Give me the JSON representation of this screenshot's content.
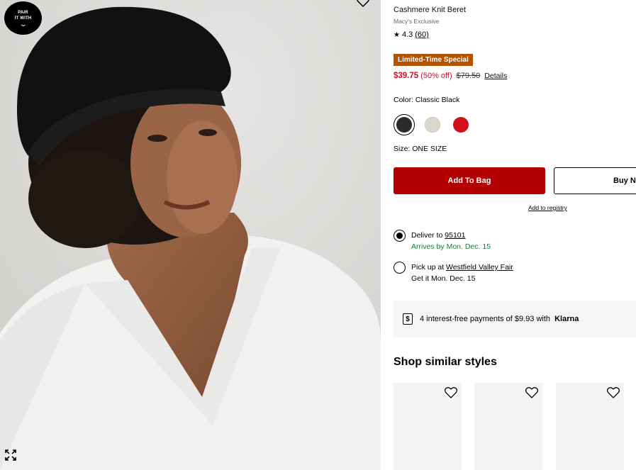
{
  "gallery": {
    "pair_line1": "PAIR",
    "pair_line2": "IT WITH",
    "icons": [
      "chevron-down-icon",
      "expand-icon",
      "heart-icon"
    ]
  },
  "product": {
    "title": "Cashmere Knit Beret",
    "brand": "Macy's Exclusive",
    "rating": "4.3",
    "review_count": "(60)",
    "badge": "Limited-Time Special",
    "sale_price": "$39.75",
    "discount": "(50% off)",
    "original_price": "$79.50",
    "details_link": "Details",
    "color_label": "Color: Classic Black",
    "swatches": [
      {
        "name": "Classic Black",
        "color": "#2b2b2b",
        "selected": true
      },
      {
        "name": "Oatmeal",
        "color": "#ddd6cc",
        "selected": false
      },
      {
        "name": "Red",
        "color": "#d0101c",
        "selected": false
      }
    ],
    "size_label": "Size: ONE SIZE"
  },
  "actions": {
    "add_to_bag": "Add To Bag",
    "buy_now": "Buy Now",
    "add_to_registry": "Add to registry"
  },
  "shipping": {
    "deliver_prefix": "Deliver to",
    "zip": "95101",
    "arrives": "Arrives by Mon. Dec. 15",
    "pickup_prefix": "Pick up at",
    "store": "Westfield Valley Fair",
    "pickup_date": "Get it Mon. Dec. 15"
  },
  "klarna": {
    "text": "4 interest-free payments of $9.93 with",
    "logo": "Klarna"
  },
  "similar": {
    "heading": "Shop similar styles"
  },
  "colors": {
    "brand_red": "#b30000",
    "sale_red": "#c8102e",
    "badge_orange": "#b35200",
    "arrival_green": "#1c7a3b"
  }
}
